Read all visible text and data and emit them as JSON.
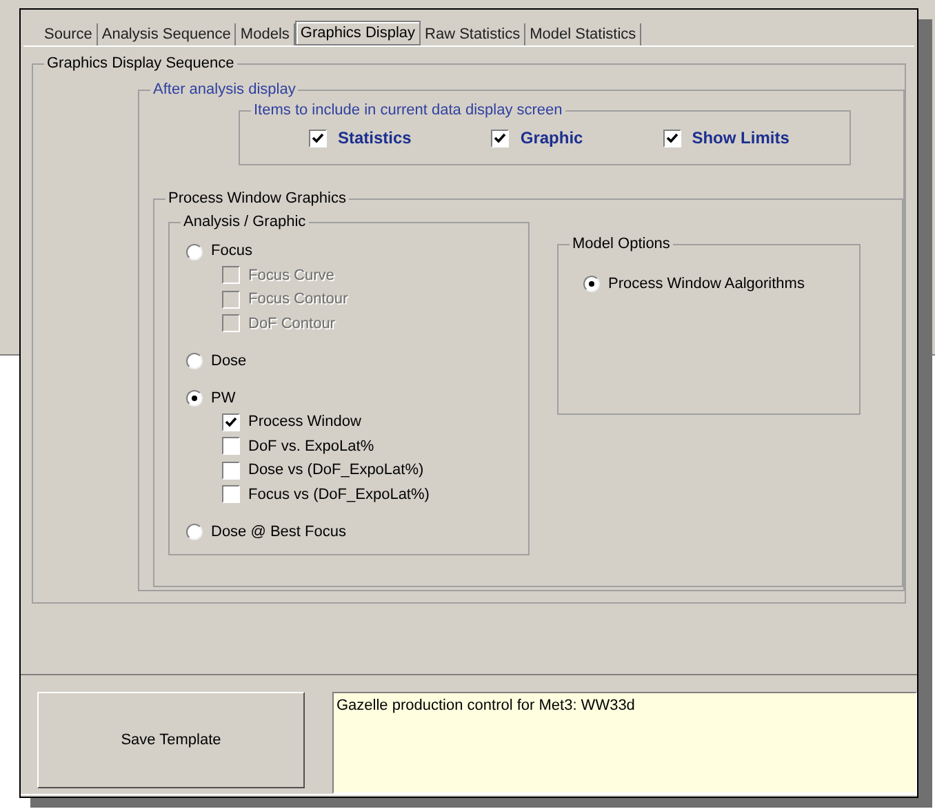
{
  "tabs": [
    {
      "label": "Source",
      "selected": false
    },
    {
      "label": "Analysis Sequence",
      "selected": false
    },
    {
      "label": "Models",
      "selected": false
    },
    {
      "label": "Graphics Display",
      "selected": true
    },
    {
      "label": "Raw Statistics",
      "selected": false
    },
    {
      "label": "Model Statistics",
      "selected": false
    }
  ],
  "display_group": {
    "title": "Graphics Display Sequence"
  },
  "after_analysis": {
    "title": "After analysis display",
    "items_title": "Items to include in current data display screen",
    "items": [
      {
        "label": "Statistics",
        "checked": true
      },
      {
        "label": "Graphic",
        "checked": true
      },
      {
        "label": "Show Limits",
        "checked": true
      }
    ]
  },
  "process_window_graphics": {
    "title": "Process Window Graphics",
    "analysis": {
      "title": "Analysis / Graphic",
      "options": [
        {
          "label": "Focus",
          "selected": false,
          "children": [
            {
              "label": "Focus Curve",
              "checked": false,
              "disabled": true
            },
            {
              "label": "Focus Contour",
              "checked": false,
              "disabled": true
            },
            {
              "label": "DoF Contour",
              "checked": false,
              "disabled": true
            }
          ]
        },
        {
          "label": "Dose",
          "selected": false
        },
        {
          "label": "PW",
          "selected": true,
          "children": [
            {
              "label": "Process Window",
              "checked": true,
              "disabled": false
            },
            {
              "label": "DoF vs. ExpoLat%",
              "checked": false,
              "disabled": false
            },
            {
              "label": "Dose vs (DoF_ExpoLat%)",
              "checked": false,
              "disabled": false
            },
            {
              "label": "Focus vs (DoF_ExpoLat%)",
              "checked": false,
              "disabled": false
            }
          ]
        },
        {
          "label": "Dose @ Best Focus",
          "selected": false
        }
      ]
    },
    "model_options": {
      "title": "Model Options",
      "options": [
        {
          "label": "Process Window Aalgorithms",
          "selected": true
        }
      ]
    }
  },
  "save_button": "Save Template",
  "description": "Gazelle production control for Met3: WW33d"
}
